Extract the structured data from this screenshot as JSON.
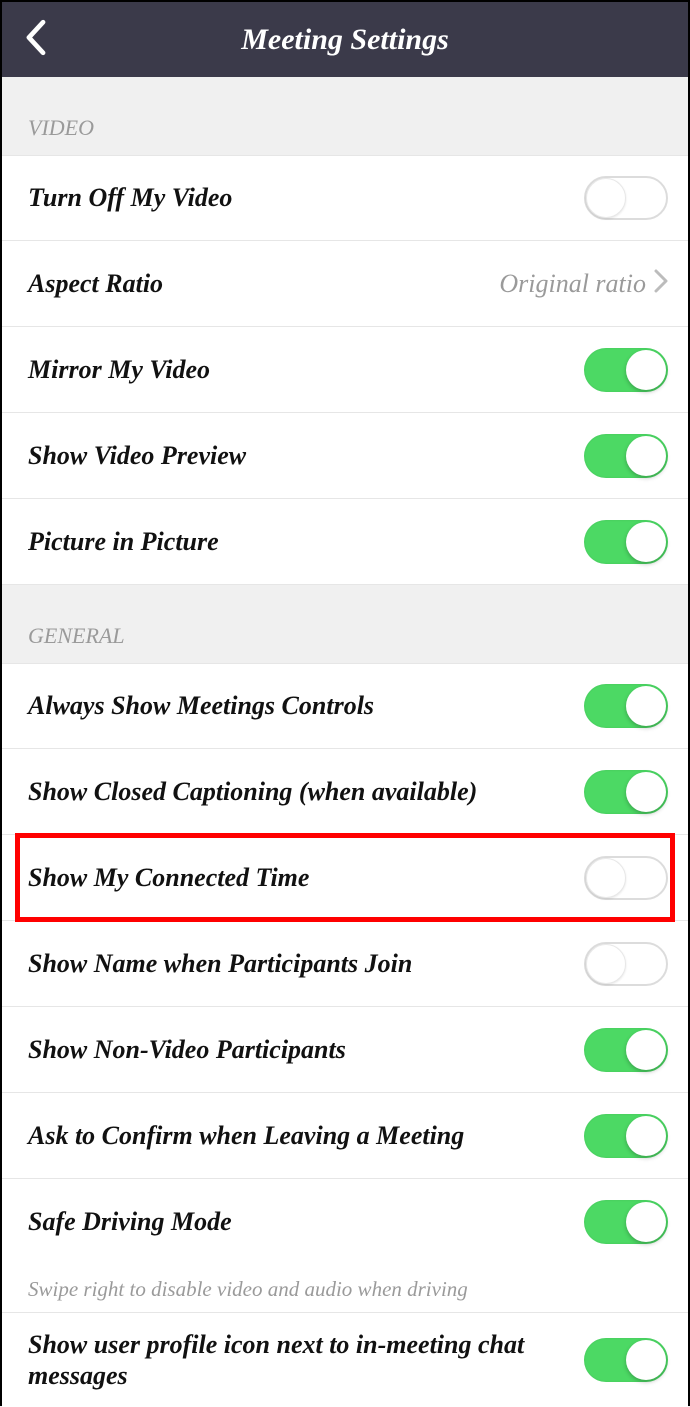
{
  "header": {
    "title": "Meeting Settings"
  },
  "sections": {
    "video": {
      "header": "VIDEO",
      "turn_off_video": {
        "label": "Turn Off My Video",
        "on": false
      },
      "aspect_ratio": {
        "label": "Aspect Ratio",
        "value": "Original ratio"
      },
      "mirror_video": {
        "label": "Mirror My Video",
        "on": true
      },
      "show_preview": {
        "label": "Show Video Preview",
        "on": true
      },
      "pip": {
        "label": "Picture in Picture",
        "on": true
      }
    },
    "general": {
      "header": "GENERAL",
      "always_show_controls": {
        "label": "Always Show Meetings Controls",
        "on": true
      },
      "closed_caption": {
        "label": "Show Closed Captioning (when available)",
        "on": true
      },
      "connected_time": {
        "label": "Show My Connected Time",
        "on": false
      },
      "show_name_join": {
        "label": "Show Name when Participants Join",
        "on": false
      },
      "non_video_participants": {
        "label": "Show Non-Video Participants",
        "on": true
      },
      "confirm_leave": {
        "label": "Ask to Confirm when Leaving a Meeting",
        "on": true
      },
      "safe_driving": {
        "label": "Safe Driving Mode",
        "on": true
      },
      "safe_driving_caption": "Swipe right to disable video and audio when driving",
      "profile_icon_chat": {
        "label": "Show user profile icon next to in-meeting chat messages",
        "on": true
      }
    }
  }
}
